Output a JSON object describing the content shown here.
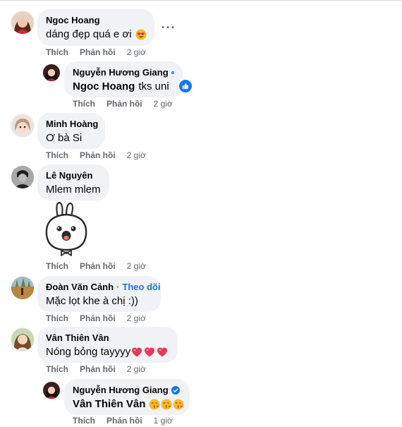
{
  "actions": {
    "like": "Thích",
    "reply": "Phản hồi"
  },
  "comments": [
    {
      "name": "Ngoc Hoang",
      "text": "dáng đẹp quá e ơi",
      "emoji": "heart-eyes",
      "time": "2 giờ",
      "more": "···"
    },
    {
      "name": "Nguyễn Hương Giang",
      "verified": true,
      "mention": "Ngoc Hoang",
      "text": "tks uni",
      "time": "2 giờ"
    },
    {
      "name": "Minh Hoàng",
      "text": "Ơ bà Si",
      "time": "2 giờ"
    },
    {
      "name": "Lê Nguyên",
      "text": "Mlem mlem",
      "sticker": "bunny-with-bowtie",
      "time": "2 giờ"
    },
    {
      "name": "Đoàn Văn Cảnh",
      "separator": "·",
      "follow": "Theo dõi",
      "text": "Mặc lọt khe à chị :))",
      "time": "2 giờ"
    },
    {
      "name": "Vân Thiên Vân",
      "text": "Nóng bỏng tayyyy",
      "emojis": [
        "heart",
        "heart",
        "heart"
      ],
      "time": "2 giờ"
    },
    {
      "name": "Nguyễn Hương Giang",
      "verified": true,
      "mention": "Vân Thiên Vân",
      "emojis": [
        "kiss",
        "kiss",
        "kiss"
      ],
      "time": "1 giờ"
    }
  ],
  "colors": {
    "bubble": "#f0f2f5",
    "link": "#216fdb",
    "meta": "#65676b",
    "verified": "#1877f2"
  }
}
